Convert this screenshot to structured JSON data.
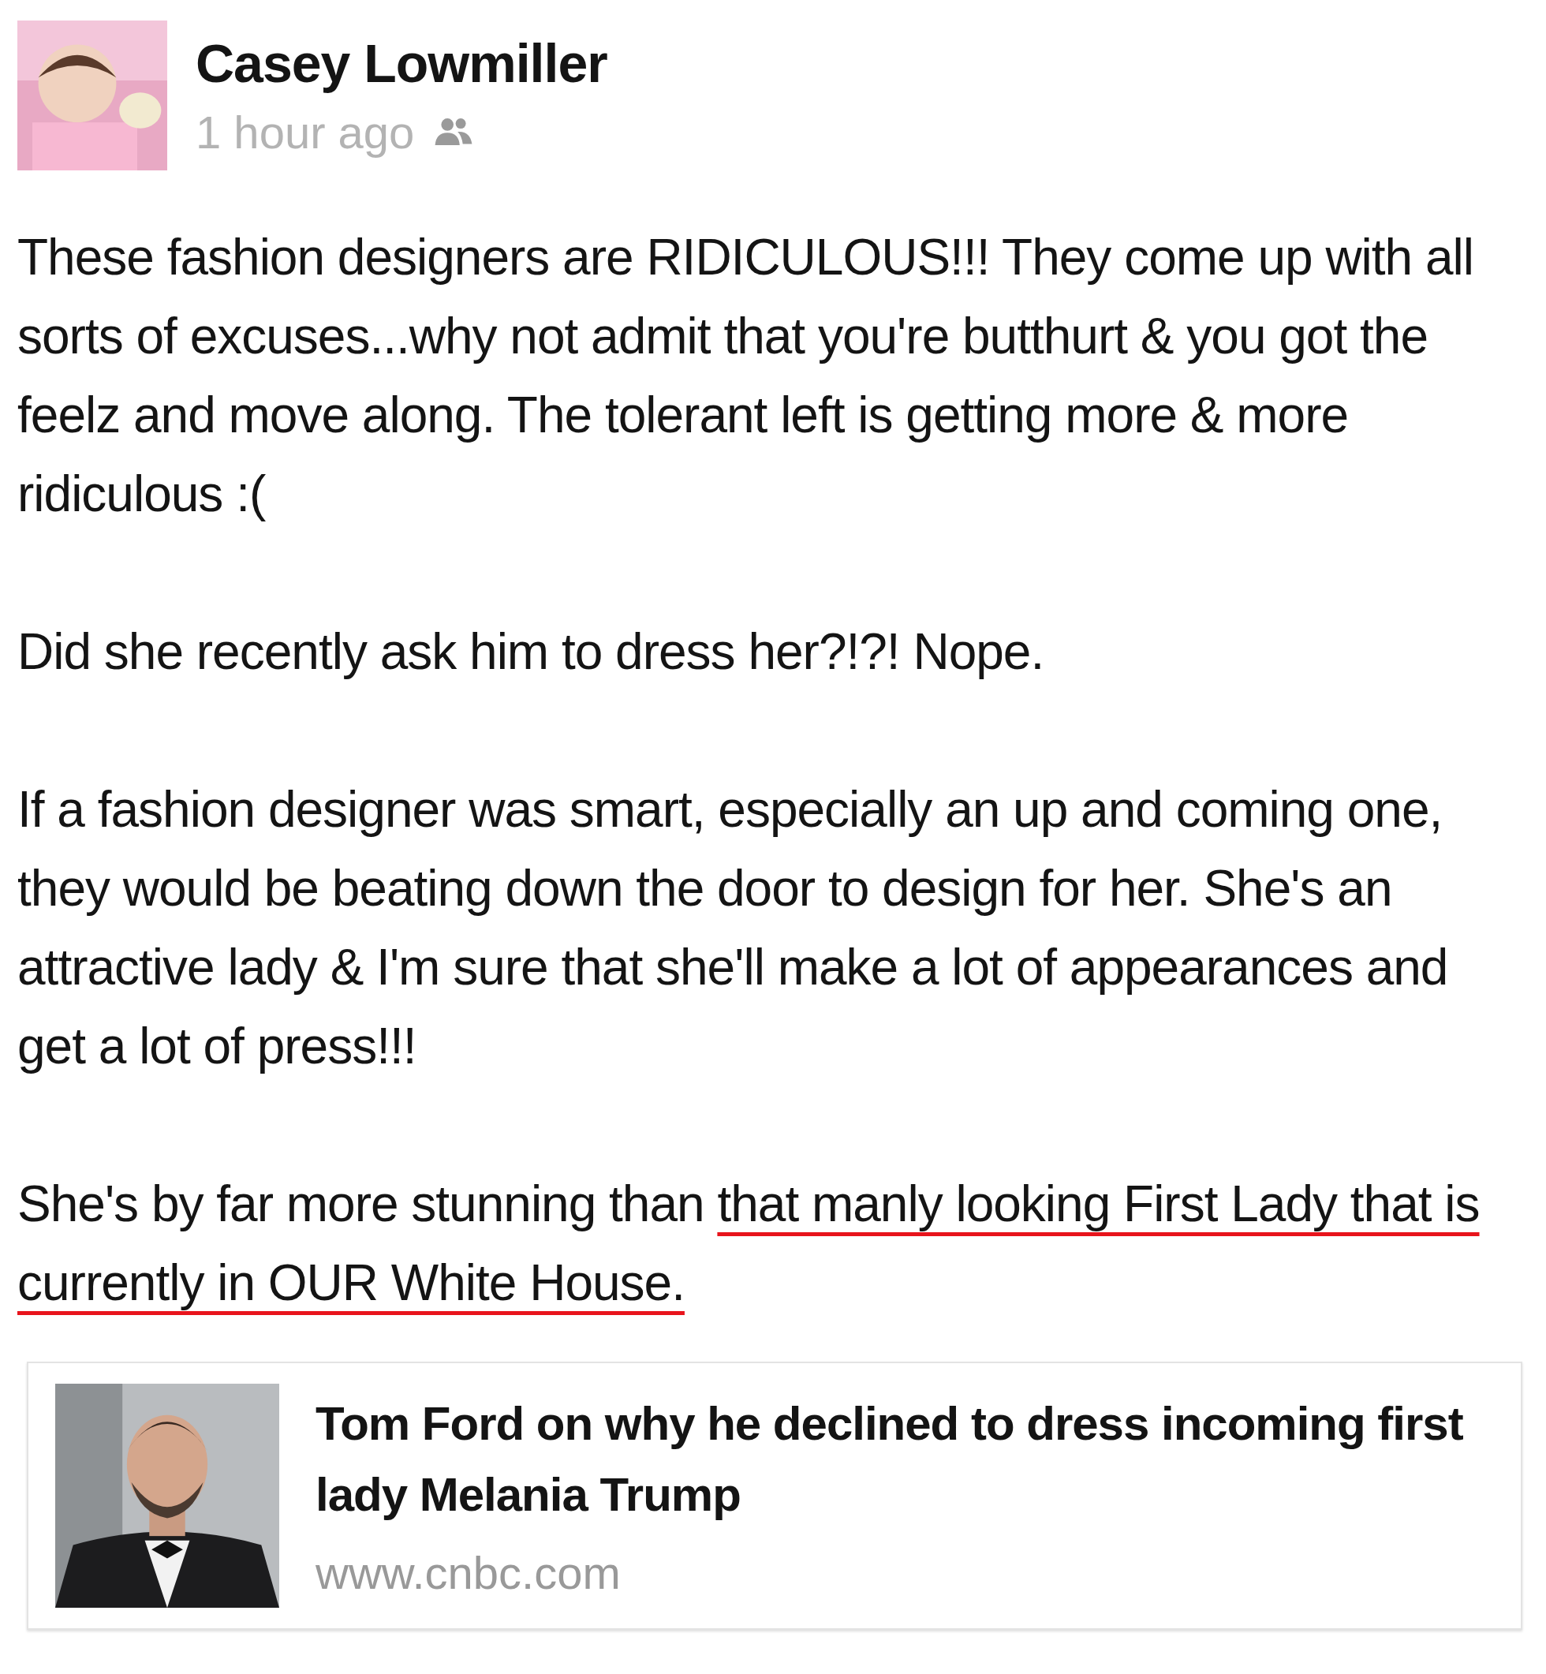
{
  "post": {
    "author": "Casey Lowmiller",
    "time": "1 hour ago",
    "paragraphs": [
      [
        {
          "text": "These fashion designers are RIDICULOUS!!! They come up with all sorts of excuses...why not admit that you're butthurt & you got the feelz and move along. The tolerant left is getting more & more ridiculous :(",
          "underlined": false
        }
      ],
      [
        {
          "text": "Did she recently ask him to dress her?!?! Nope.",
          "underlined": false
        }
      ],
      [
        {
          "text": "If a fashion designer was smart, especially an up and coming one, they would be beating down the door to design for her. She's an attractive lady & I'm sure that she'll make a lot of appearances and get a lot of press!!!",
          "underlined": false
        }
      ],
      [
        {
          "text": "She's by far more stunning than ",
          "underlined": false
        },
        {
          "text": "that manly looking First Lady that is currently in OUR White House.",
          "underlined": true
        }
      ]
    ],
    "link": {
      "title": "Tom Ford on why he declined to dress incoming first lady Melania Trump",
      "domain": "www.cnbc.com"
    }
  }
}
